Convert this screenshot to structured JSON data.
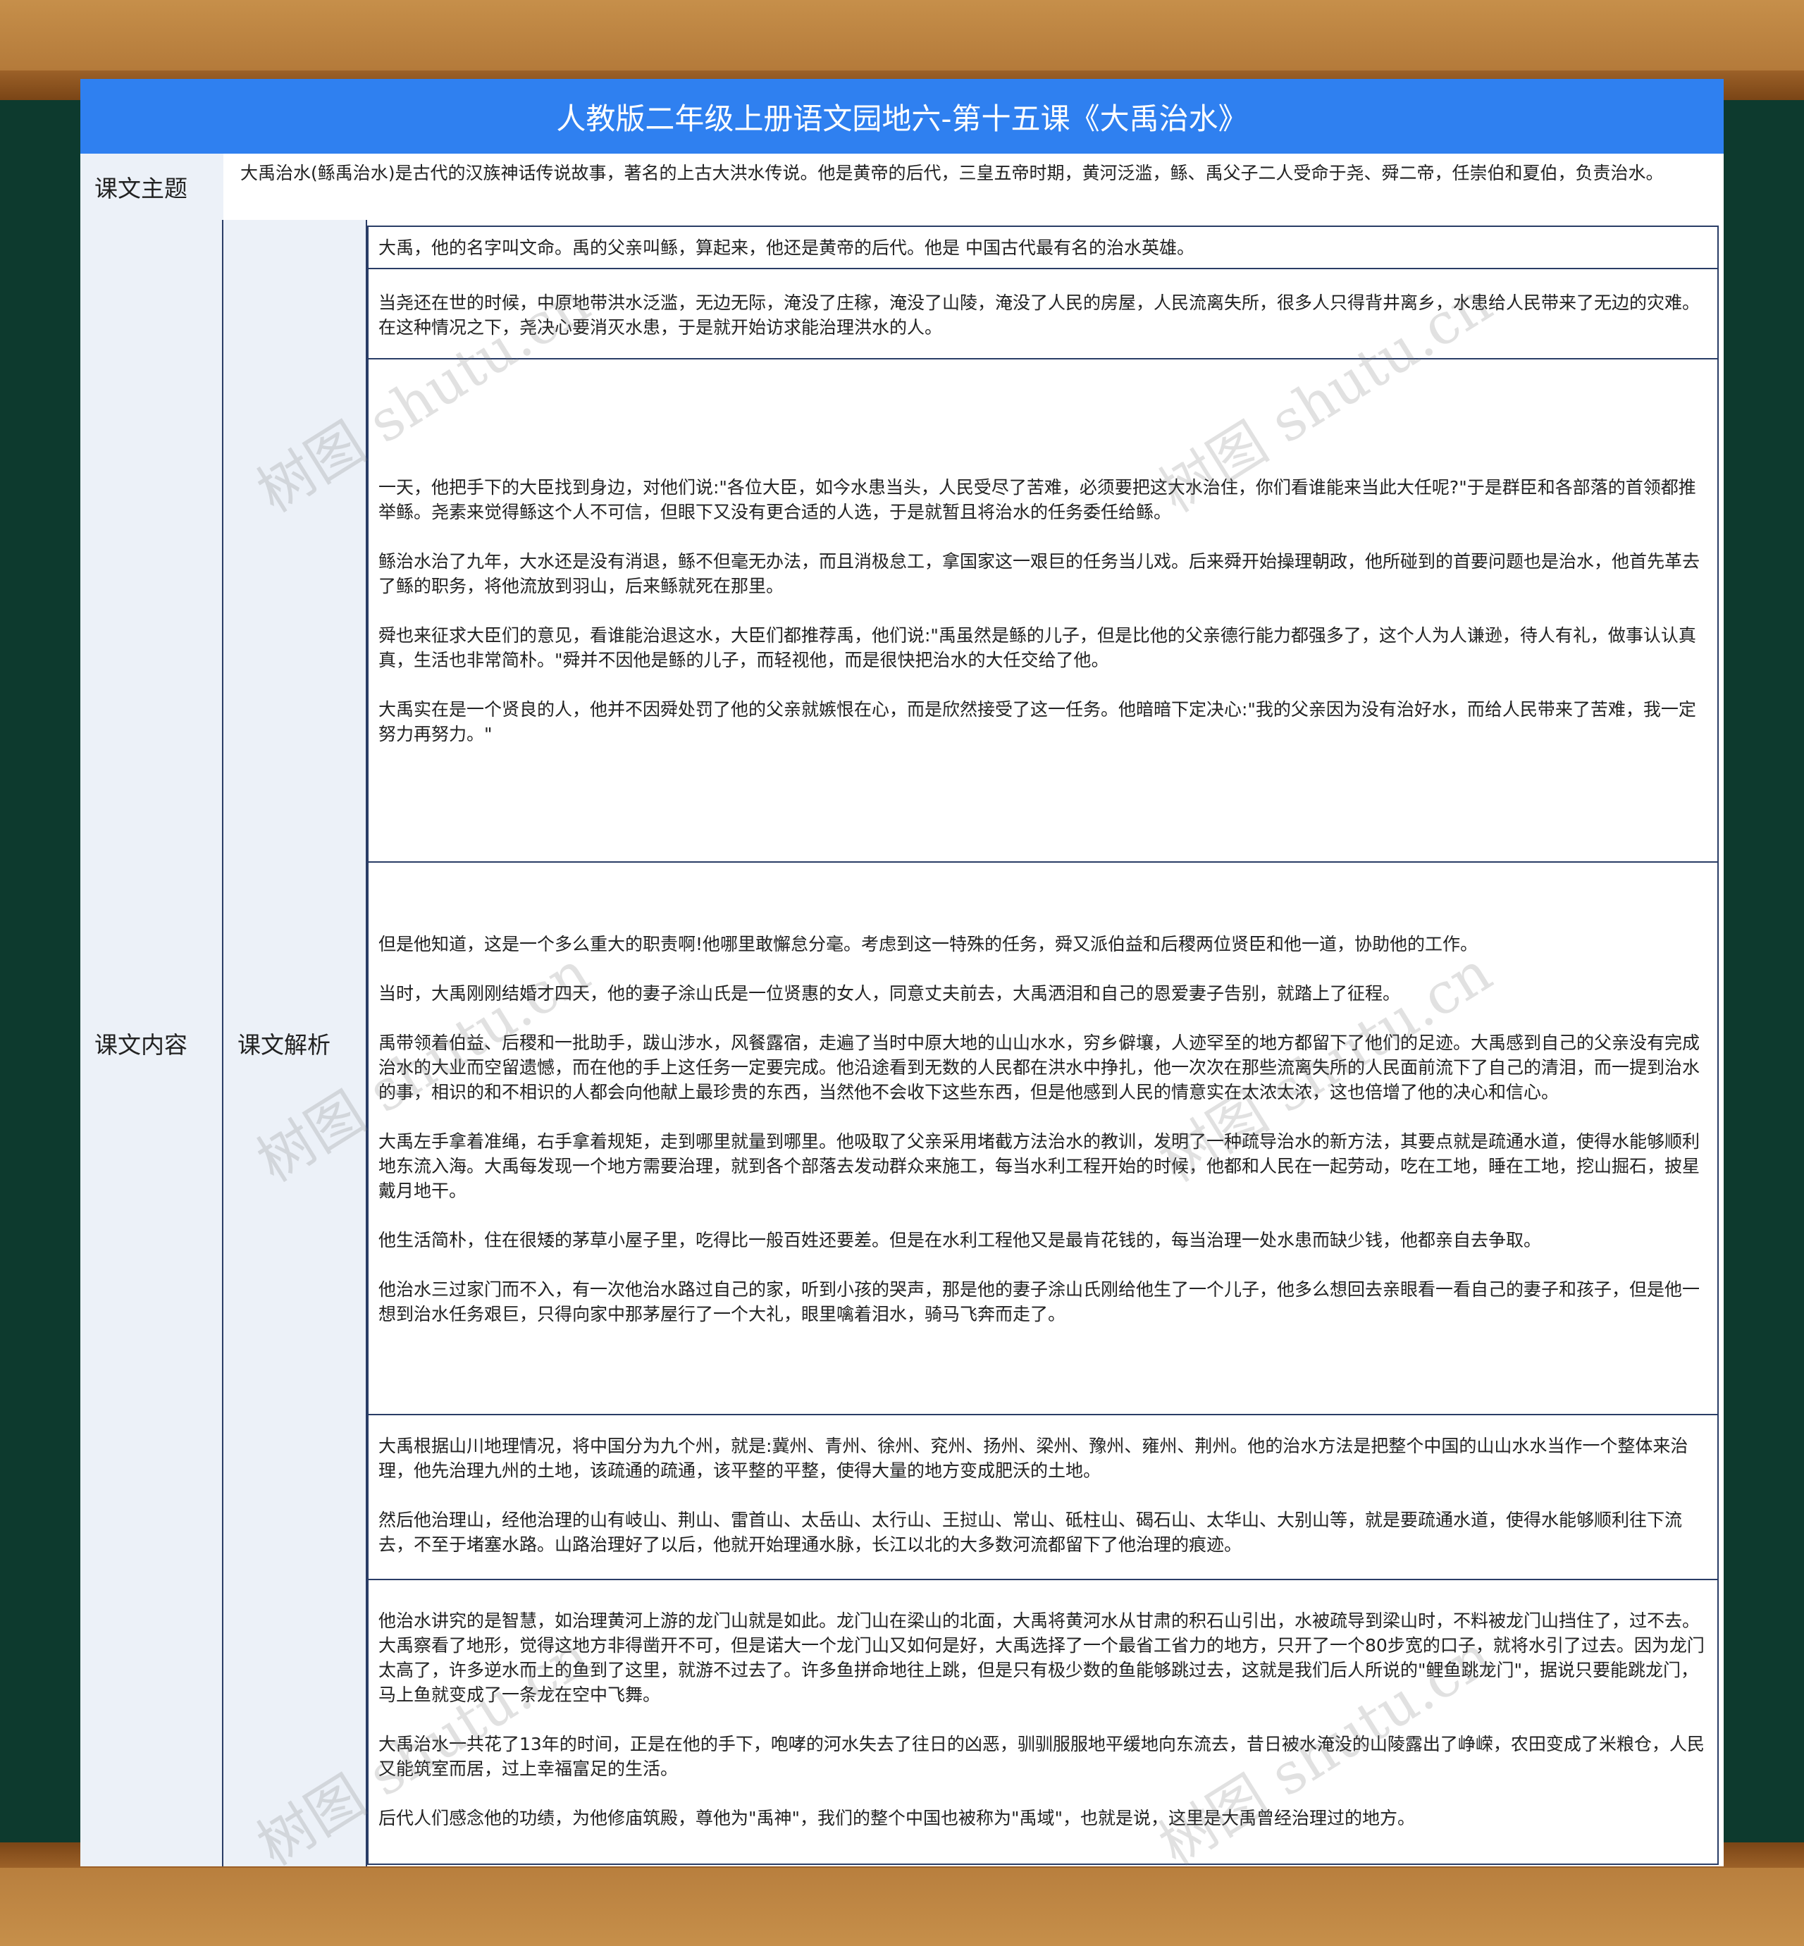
{
  "title": "人教版二年级上册语文园地六-第十五课《大禹治水》",
  "theme": {
    "label": "课文主题",
    "text": "大禹治水(鲧禹治水)是古代的汉族神话传说故事，著名的上古大洪水传说。他是黄帝的后代，三皇五帝时期，黄河泛滥，鲧、禹父子二人受命于尧、舜二帝，任崇伯和夏伯，负责治水。"
  },
  "content": {
    "label": "课文内容",
    "analysis_label": "课文解析",
    "paragraphs": [
      "大禹，他的名字叫文命。禹的父亲叫鲧，算起来，他还是黄帝的后代。他是 中国古代最有名的治水英雄。",
      "当尧还在世的时候，中原地带洪水泛滥，无边无际，淹没了庄稼，淹没了山陵，淹没了人民的房屋，人民流离失所，很多人只得背井离乡，水患给人民带来了无边的灾难。在这种情况之下，尧决心要消灭水患，于是就开始访求能治理洪水的人。",
      "一天，他把手下的大臣找到身边，对他们说:\"各位大臣，如今水患当头，人民受尽了苦难，必须要把这大水治住，你们看谁能来当此大任呢?\"于是群臣和各部落的首领都推举鲧。尧素来觉得鲧这个人不可信，但眼下又没有更合适的人选，于是就暂且将治水的任务委任给鲧。\n\n鲧治水治了九年，大水还是没有消退，鲧不但毫无办法，而且消极怠工，拿国家这一艰巨的任务当儿戏。后来舜开始操理朝政，他所碰到的首要问题也是治水，他首先革去了鲧的职务，将他流放到羽山，后来鲧就死在那里。\n\n舜也来征求大臣们的意见，看谁能治退这水，大臣们都推荐禹，他们说:\"禹虽然是鲧的儿子，但是比他的父亲德行能力都强多了，这个人为人谦逊，待人有礼，做事认认真真，生活也非常简朴。\"舜并不因他是鲧的儿子，而轻视他，而是很快把治水的大任交给了他。\n\n大禹实在是一个贤良的人，他并不因舜处罚了他的父亲就嫉恨在心，而是欣然接受了这一任务。他暗暗下定决心:\"我的父亲因为没有治好水，而给人民带来了苦难，我一定努力再努力。\"",
      "但是他知道，这是一个多么重大的职责啊!他哪里敢懈怠分毫。考虑到这一特殊的任务，舜又派伯益和后稷两位贤臣和他一道，协助他的工作。\n\n当时，大禹刚刚结婚才四天，他的妻子涂山氏是一位贤惠的女人，同意丈夫前去，大禹洒泪和自己的恩爱妻子告别，就踏上了征程。\n\n禹带领着伯益、后稷和一批助手，跋山涉水，风餐露宿，走遍了当时中原大地的山山水水，穷乡僻壤，人迹罕至的地方都留下了他们的足迹。大禹感到自己的父亲没有完成治水的大业而空留遗憾，而在他的手上这任务一定要完成。他沿途看到无数的人民都在洪水中挣扎，他一次次在那些流离失所的人民面前流下了自己的清泪，而一提到治水的事，相识的和不相识的人都会向他献上最珍贵的东西，当然他不会收下这些东西，但是他感到人民的情意实在太浓太浓，这也倍增了他的决心和信心。\n\n大禹左手拿着准绳，右手拿着规矩，走到哪里就量到哪里。他吸取了父亲采用堵截方法治水的教训，发明了一种疏导治水的新方法，其要点就是疏通水道，使得水能够顺利地东流入海。大禹每发现一个地方需要治理，就到各个部落去发动群众来施工，每当水利工程开始的时候，他都和人民在一起劳动，吃在工地，睡在工地，挖山掘石，披星戴月地干。\n\n他生活简朴，住在很矮的茅草小屋子里，吃得比一般百姓还要差。但是在水利工程他又是最肯花钱的，每当治理一处水患而缺少钱，他都亲自去争取。\n\n他治水三过家门而不入，有一次他治水路过自己的家，听到小孩的哭声，那是他的妻子涂山氏刚给他生了一个儿子，他多么想回去亲眼看一看自己的妻子和孩子，但是他一想到治水任务艰巨，只得向家中那茅屋行了一个大礼，眼里噙着泪水，骑马飞奔而走了。",
      "大禹根据山川地理情况，将中国分为九个州，就是:冀州、青州、徐州、兖州、扬州、梁州、豫州、雍州、荆州。他的治水方法是把整个中国的山山水水当作一个整体来治理，他先治理九州的土地，该疏通的疏通，该平整的平整，使得大量的地方变成肥沃的土地。\n\n然后他治理山，经他治理的山有岐山、荆山、雷首山、太岳山、太行山、王挝山、常山、砥柱山、碣石山、太华山、大别山等，就是要疏通水道，使得水能够顺利往下流去，不至于堵塞水路。山路治理好了以后，他就开始理通水脉，长江以北的大多数河流都留下了他治理的痕迹。",
      "他治水讲究的是智慧，如治理黄河上游的龙门山就是如此。龙门山在梁山的北面，大禹将黄河水从甘肃的积石山引出，水被疏导到梁山时，不料被龙门山挡住了，过不去。大禹察看了地形，觉得这地方非得凿开不可，但是诺大一个龙门山又如何是好，大禹选择了一个最省工省力的地方，只开了一个80步宽的口子，就将水引了过去。因为龙门太高了，许多逆水而上的鱼到了这里，就游不过去了。许多鱼拼命地往上跳，但是只有极少数的鱼能够跳过去，这就是我们后人所说的\"鲤鱼跳龙门\"，据说只要能跳龙门，马上鱼就变成了一条龙在空中飞舞。\n\n大禹治水一共花了13年的时间，正是在他的手下，咆哮的河水失去了往日的凶恶，驯驯服服地平缓地向东流去，昔日被水淹没的山陵露出了峥嵘，农田变成了米粮仓，人民又能筑室而居，过上幸福富足的生活。\n\n后代人们感念他的功绩，为他修庙筑殿，尊他为\"禹神\"，我们的整个中国也被称为\"禹域\"，也就是说，这里是大禹曾经治理过的地方。"
    ]
  },
  "watermark": "树图 shutu.cn"
}
